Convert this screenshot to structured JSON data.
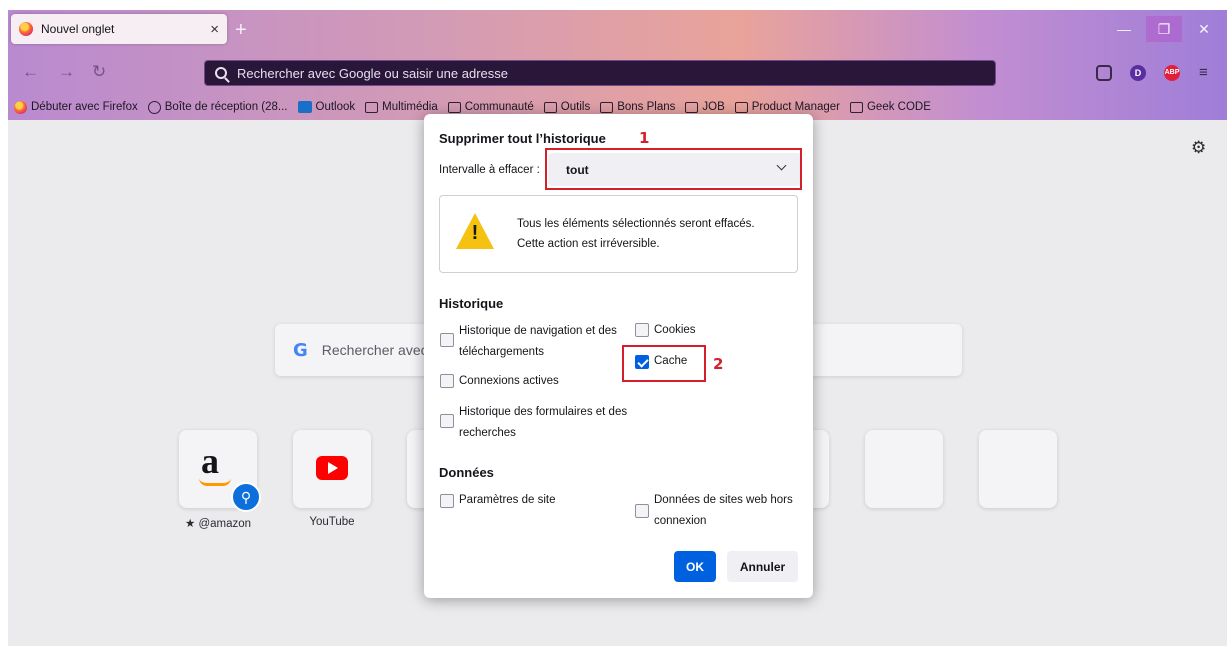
{
  "browser": {
    "tab_title": "Nouvel onglet",
    "tab_close": "×",
    "new_tab": "+",
    "url_placeholder": "Rechercher avec Google ou saisir une adresse",
    "bookmarks": [
      "Débuter avec Firefox",
      "Boîte de réception (28...",
      "Outlook",
      "Multimédia",
      "Communauté",
      "Outils",
      "Bons Plans",
      "JOB",
      "Product Manager",
      "Geek CODE"
    ],
    "account_initial": "D",
    "adblock_label": "ABP"
  },
  "newtab": {
    "search_placeholder": "Rechercher avec",
    "shortcuts": [
      {
        "label": "★ @amazon"
      },
      {
        "label": "YouTube"
      }
    ]
  },
  "dialog": {
    "title": "Supprimer tout l’historique",
    "range_label": "Intervalle à effacer :",
    "range_value": "tout",
    "warning_line1": "Tous les éléments sélectionnés seront effacés.",
    "warning_line2": "Cette action est irréversible.",
    "history_heading": "Historique",
    "history_items": {
      "browsing_line1": "Historique de navigation et des",
      "browsing_line2": "téléchargements",
      "cookies": "Cookies",
      "cache": "Cache",
      "active_logins": "Connexions actives",
      "forms_line1": "Historique des formulaires et des",
      "forms_line2": "recherches"
    },
    "data_heading": "Données",
    "data_items": {
      "site_prefs": "Paramètres de site",
      "offline_line1": "Données de sites web hors",
      "offline_line2": "connexion"
    },
    "checked": {
      "cache": true
    },
    "ok_label": "OK",
    "cancel_label": "Annuler"
  },
  "annotations": [
    "1",
    "2"
  ],
  "colors": {
    "annotation_red": "#d4202a",
    "primary_blue": "#0061e0",
    "warning_yellow": "#f5c211"
  }
}
